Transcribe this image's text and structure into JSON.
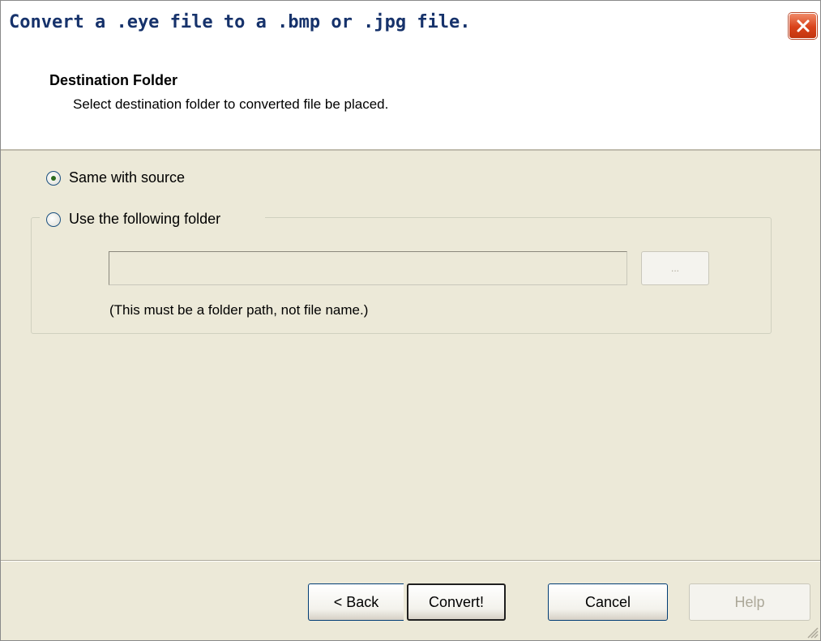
{
  "window": {
    "title": "Convert a .eye file to a .bmp or .jpg file."
  },
  "header": {
    "title": "Destination Folder",
    "subtitle": "Select destination folder to converted file be placed."
  },
  "options": {
    "same_with_source": {
      "label": "Same with source",
      "checked": true
    },
    "use_following_folder": {
      "label": "Use the following folder",
      "checked": false
    }
  },
  "folder": {
    "value": "",
    "browse_label": "...",
    "hint": "(This must be a folder path, not file name.)"
  },
  "buttons": {
    "back": "< Back",
    "convert": "Convert!",
    "cancel": "Cancel",
    "help": "Help"
  },
  "icons": {
    "close": "close-icon",
    "radio": "radio-icon",
    "size_grip": "size-grip-icon"
  },
  "colors": {
    "background": "#ece9d8",
    "title_text": "#16326b",
    "close_button": "#d9421a",
    "disabled_text": "#aca899"
  }
}
